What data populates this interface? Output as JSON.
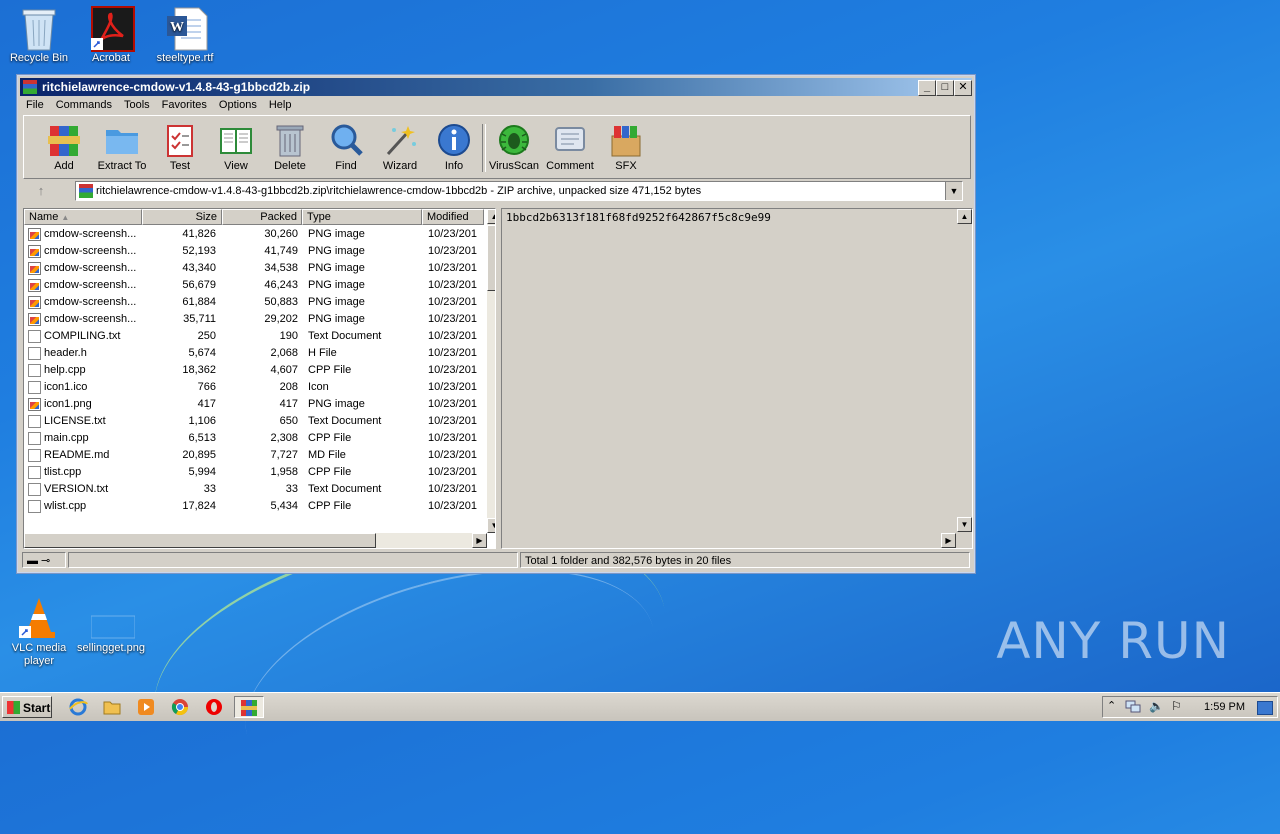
{
  "desktop": {
    "icons": [
      {
        "label": "Recycle Bin"
      },
      {
        "label": "Acrobat"
      },
      {
        "label": "steeltype.rtf"
      },
      {
        "label": "VLC media player"
      },
      {
        "label": "sellingget.png"
      }
    ],
    "watermark": "ANY RUN"
  },
  "window": {
    "title": "ritchielawrence-cmdow-v1.4.8-43-g1bbcd2b.zip",
    "controls": {
      "minimize": "_",
      "maximize": "□",
      "close": "✕"
    },
    "menu": [
      "File",
      "Commands",
      "Tools",
      "Favorites",
      "Options",
      "Help"
    ],
    "toolbar": [
      "Add",
      "Extract To",
      "Test",
      "View",
      "Delete",
      "Find",
      "Wizard",
      "Info",
      "VirusScan",
      "Comment",
      "SFX"
    ],
    "address": "ritchielawrence-cmdow-v1.4.8-43-g1bbcd2b.zip\\ritchielawrence-cmdow-1bbcd2b - ZIP archive, unpacked size 471,152 bytes",
    "columns": {
      "name": "Name",
      "size": "Size",
      "packed": "Packed",
      "type": "Type",
      "modified": "Modified"
    },
    "files": [
      {
        "name": "cmdow-screensh...",
        "size": "41,826",
        "packed": "30,260",
        "type": "PNG image",
        "modified": "10/23/201",
        "icon": "png"
      },
      {
        "name": "cmdow-screensh...",
        "size": "52,193",
        "packed": "41,749",
        "type": "PNG image",
        "modified": "10/23/201",
        "icon": "png"
      },
      {
        "name": "cmdow-screensh...",
        "size": "43,340",
        "packed": "34,538",
        "type": "PNG image",
        "modified": "10/23/201",
        "icon": "png"
      },
      {
        "name": "cmdow-screensh...",
        "size": "56,679",
        "packed": "46,243",
        "type": "PNG image",
        "modified": "10/23/201",
        "icon": "png"
      },
      {
        "name": "cmdow-screensh...",
        "size": "61,884",
        "packed": "50,883",
        "type": "PNG image",
        "modified": "10/23/201",
        "icon": "png"
      },
      {
        "name": "cmdow-screensh...",
        "size": "35,711",
        "packed": "29,202",
        "type": "PNG image",
        "modified": "10/23/201",
        "icon": "png"
      },
      {
        "name": "COMPILING.txt",
        "size": "250",
        "packed": "190",
        "type": "Text Document",
        "modified": "10/23/201",
        "icon": "doc"
      },
      {
        "name": "header.h",
        "size": "5,674",
        "packed": "2,068",
        "type": "H File",
        "modified": "10/23/201",
        "icon": "doc"
      },
      {
        "name": "help.cpp",
        "size": "18,362",
        "packed": "4,607",
        "type": "CPP File",
        "modified": "10/23/201",
        "icon": "doc"
      },
      {
        "name": "icon1.ico",
        "size": "766",
        "packed": "208",
        "type": "Icon",
        "modified": "10/23/201",
        "icon": "doc"
      },
      {
        "name": "icon1.png",
        "size": "417",
        "packed": "417",
        "type": "PNG image",
        "modified": "10/23/201",
        "icon": "png"
      },
      {
        "name": "LICENSE.txt",
        "size": "1,106",
        "packed": "650",
        "type": "Text Document",
        "modified": "10/23/201",
        "icon": "doc"
      },
      {
        "name": "main.cpp",
        "size": "6,513",
        "packed": "2,308",
        "type": "CPP File",
        "modified": "10/23/201",
        "icon": "doc"
      },
      {
        "name": "README.md",
        "size": "20,895",
        "packed": "7,727",
        "type": "MD File",
        "modified": "10/23/201",
        "icon": "doc"
      },
      {
        "name": "tlist.cpp",
        "size": "5,994",
        "packed": "1,958",
        "type": "CPP File",
        "modified": "10/23/201",
        "icon": "doc"
      },
      {
        "name": "VERSION.txt",
        "size": "33",
        "packed": "33",
        "type": "Text Document",
        "modified": "10/23/201",
        "icon": "doc"
      },
      {
        "name": "wlist.cpp",
        "size": "17,824",
        "packed": "5,434",
        "type": "CPP File",
        "modified": "10/23/201",
        "icon": "doc"
      }
    ],
    "comment": "1bbcd2b6313f181f68fd9252f642867f5c8c9e99",
    "status": "Total 1 folder and 382,576 bytes in 20 files"
  },
  "taskbar": {
    "start": "Start",
    "clock": "1:59 PM"
  }
}
